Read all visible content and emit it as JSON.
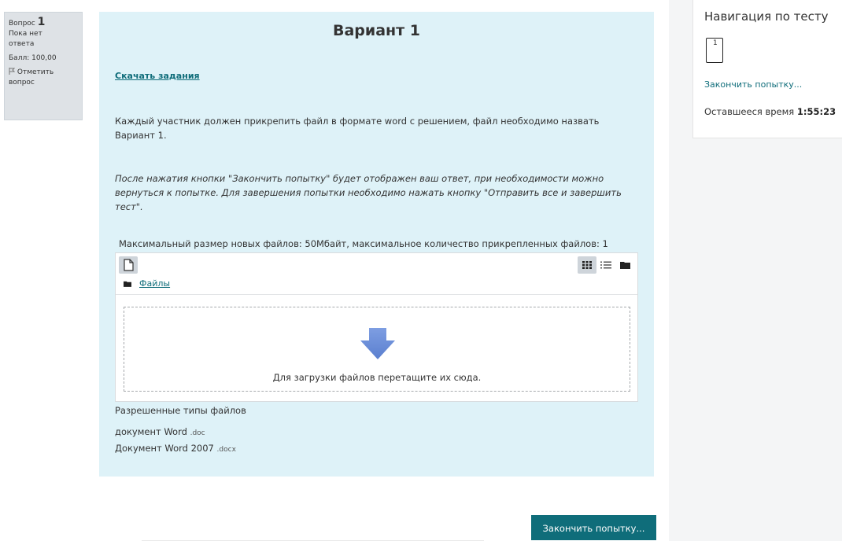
{
  "question_info": {
    "label": "Вопрос",
    "number": "1",
    "status_line1": "Пока нет",
    "status_line2": "ответа",
    "score": "Балл: 100,00",
    "flag_line1": "Отметить",
    "flag_line2": "вопрос"
  },
  "question": {
    "title": "Вариант 1",
    "download_link": "Скачать задания",
    "paragraph1": "Каждый участник должен прикрепить файл в формате word с решением, файл необходимо назвать Вариант 1.",
    "paragraph2": "После нажатия кнопки \"Закончить попытку\" будет отображен ваш ответ, при необходимости можно вернуться к попытке. Для завершения попытки необходимо нажать кнопку \"Отправить все и завершить тест\".",
    "max_size": "Максимальный размер новых файлов: 50Мбайт, максимальное количество прикрепленных файлов: 1",
    "filemanager": {
      "path_label": "Файлы",
      "drop_text": "Для загрузки файлов перетащите их сюда."
    },
    "allowed_types_title": "Разрешенные типы файлов",
    "allowed_types": [
      {
        "name": "документ Word",
        "ext": ".doc"
      },
      {
        "name": "Документ Word 2007",
        "ext": ".docx"
      }
    ]
  },
  "navigation": {
    "title": "Навигация по тесту",
    "question_button": "1",
    "finish_link": "Закончить попытку...",
    "time_label": "Оставшееся время",
    "time_value": "1:55:23"
  },
  "footer": {
    "finish_button": "Закончить попытку..."
  },
  "colors": {
    "accent": "#0f6d7a",
    "content_bg": "#def2f8",
    "drop_arrow": "#6b8fd6"
  },
  "icons": {
    "add_file": "file-icon",
    "grid_view": "grid-icon",
    "list_view": "list-icon",
    "tree_view": "folder-icon",
    "path_folder": "folder-icon",
    "drop_arrow": "arrow-down-icon",
    "flag": "flag-icon"
  }
}
